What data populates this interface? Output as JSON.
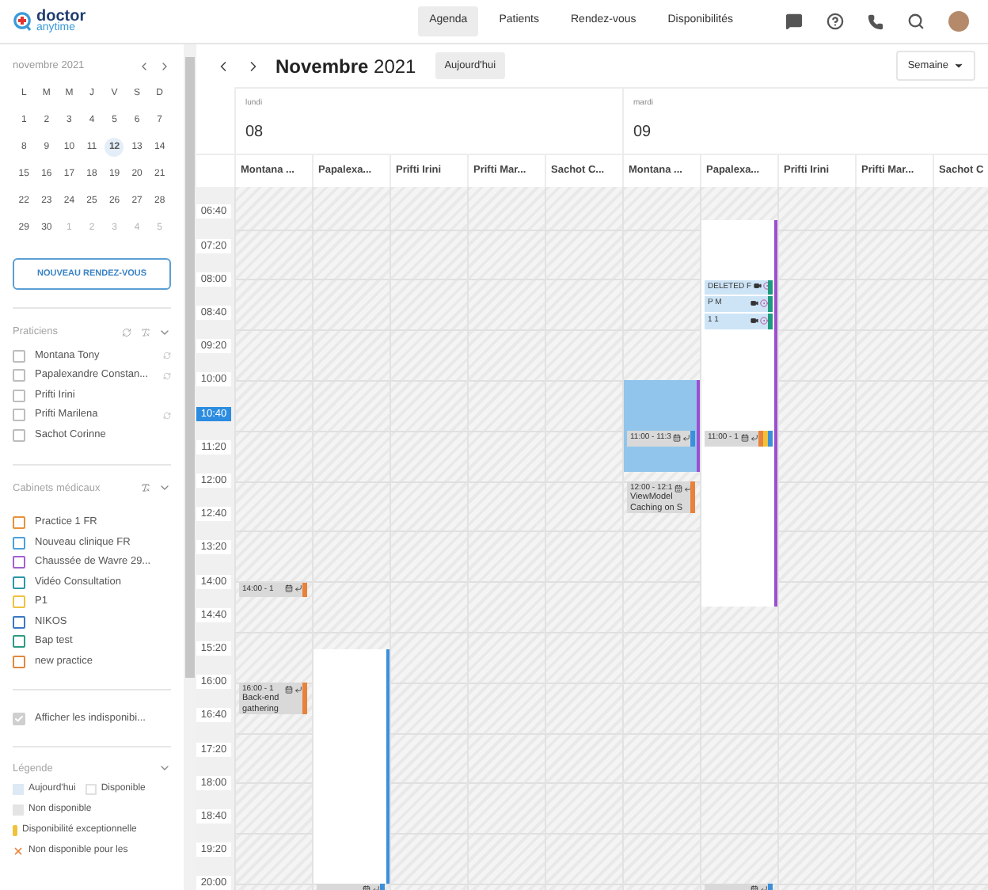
{
  "brand": {
    "name": "doctor",
    "tagline": "anytime"
  },
  "nav": [
    {
      "label": "Agenda",
      "selected": true
    },
    {
      "label": "Patients",
      "selected": false
    },
    {
      "label": "Rendez-vous",
      "selected": false
    },
    {
      "label": "Disponibilités",
      "selected": false
    }
  ],
  "mini_calendar": {
    "month": "novembre 2021",
    "weekdays": [
      "L",
      "M",
      "M",
      "J",
      "V",
      "S",
      "D"
    ],
    "weeks": [
      [
        {
          "day": "1",
          "outside": false,
          "selected": false
        },
        {
          "day": "2",
          "outside": false,
          "selected": false
        },
        {
          "day": "3",
          "outside": false,
          "selected": false
        },
        {
          "day": "4",
          "outside": false,
          "selected": false
        },
        {
          "day": "5",
          "outside": false,
          "selected": false
        },
        {
          "day": "6",
          "outside": false,
          "selected": false
        },
        {
          "day": "7",
          "outside": false,
          "selected": false
        }
      ],
      [
        {
          "day": "8",
          "outside": false,
          "selected": false
        },
        {
          "day": "9",
          "outside": false,
          "selected": false
        },
        {
          "day": "10",
          "outside": false,
          "selected": false
        },
        {
          "day": "11",
          "outside": false,
          "selected": false
        },
        {
          "day": "12",
          "outside": false,
          "selected": true
        },
        {
          "day": "13",
          "outside": false,
          "selected": false
        },
        {
          "day": "14",
          "outside": false,
          "selected": false
        }
      ],
      [
        {
          "day": "15",
          "outside": false,
          "selected": false
        },
        {
          "day": "16",
          "outside": false,
          "selected": false
        },
        {
          "day": "17",
          "outside": false,
          "selected": false
        },
        {
          "day": "18",
          "outside": false,
          "selected": false
        },
        {
          "day": "19",
          "outside": false,
          "selected": false
        },
        {
          "day": "20",
          "outside": false,
          "selected": false
        },
        {
          "day": "21",
          "outside": false,
          "selected": false
        }
      ],
      [
        {
          "day": "22",
          "outside": false,
          "selected": false
        },
        {
          "day": "23",
          "outside": false,
          "selected": false
        },
        {
          "day": "24",
          "outside": false,
          "selected": false
        },
        {
          "day": "25",
          "outside": false,
          "selected": false
        },
        {
          "day": "26",
          "outside": false,
          "selected": false
        },
        {
          "day": "27",
          "outside": false,
          "selected": false
        },
        {
          "day": "28",
          "outside": false,
          "selected": false
        }
      ],
      [
        {
          "day": "29",
          "outside": false,
          "selected": false
        },
        {
          "day": "30",
          "outside": false,
          "selected": false
        },
        {
          "day": "1",
          "outside": true,
          "selected": false
        },
        {
          "day": "2",
          "outside": true,
          "selected": false
        },
        {
          "day": "3",
          "outside": true,
          "selected": false
        },
        {
          "day": "4",
          "outside": true,
          "selected": false
        },
        {
          "day": "5",
          "outside": true,
          "selected": false
        }
      ]
    ]
  },
  "new_appointment_button": "NOUVEAU RENDEZ-VOUS",
  "practitioners": {
    "title": "Praticiens",
    "items": [
      {
        "name": "Montana Tony",
        "checked": false,
        "synced": true
      },
      {
        "name": "Papalexandre Constan...",
        "checked": false,
        "synced": true
      },
      {
        "name": "Prifti Irini",
        "checked": false,
        "synced": false
      },
      {
        "name": "Prifti Marilena",
        "checked": false,
        "synced": true
      },
      {
        "name": "Sachot Corinne",
        "checked": false,
        "synced": false
      }
    ]
  },
  "practices": {
    "title": "Cabinets médicaux",
    "items": [
      {
        "name": "Practice 1 FR",
        "checked": false,
        "color": "#e8913a"
      },
      {
        "name": "Nouveau clinique FR",
        "checked": false,
        "color": "#4aa0dc"
      },
      {
        "name": "Chaussée de Wavre 29...",
        "checked": false,
        "color": "#a35fd0"
      },
      {
        "name": "Vidéo Consultation",
        "checked": false,
        "color": "#2a98a8"
      },
      {
        "name": "P1",
        "checked": false,
        "color": "#f0c23c"
      },
      {
        "name": "NIKOS",
        "checked": false,
        "color": "#3a78c4"
      },
      {
        "name": "Bap test",
        "checked": false,
        "color": "#2e9a84"
      },
      {
        "name": "new practice",
        "checked": false,
        "color": "#e0883c"
      }
    ]
  },
  "show_unavailable": {
    "label": "Afficher les indisponibi...",
    "checked": true
  },
  "legend": {
    "title": "Légende",
    "items": [
      {
        "kind": "today",
        "label": "Aujourd'hui"
      },
      {
        "kind": "available",
        "label": "Disponible"
      },
      {
        "kind": "unavailable",
        "label": "Non disponible"
      },
      {
        "kind": "exceptional",
        "label": "Disponibilité exceptionnelle"
      },
      {
        "kind": "blocked",
        "label": "Non disponible pour les"
      }
    ]
  },
  "toolbar": {
    "title": "**Novembre** 2021",
    "today_button": "Aujourd'hui",
    "view": "Semaine"
  },
  "time_labels": [
    {
      "time": "06:40",
      "current": false
    },
    {
      "time": "07:20",
      "current": false
    },
    {
      "time": "08:00",
      "current": false
    },
    {
      "time": "08:40",
      "current": false
    },
    {
      "time": "09:20",
      "current": false
    },
    {
      "time": "10:00",
      "current": false
    },
    {
      "time": "10:40",
      "current": true
    },
    {
      "time": "11:20",
      "current": false
    },
    {
      "time": "12:00",
      "current": false
    },
    {
      "time": "12:40",
      "current": false
    },
    {
      "time": "13:20",
      "current": false
    },
    {
      "time": "14:00",
      "current": false
    },
    {
      "time": "14:40",
      "current": false
    },
    {
      "time": "15:20",
      "current": false
    },
    {
      "time": "16:00",
      "current": false
    },
    {
      "time": "16:40",
      "current": false
    },
    {
      "time": "17:20",
      "current": false
    },
    {
      "time": "18:00",
      "current": false
    },
    {
      "time": "18:40",
      "current": false
    },
    {
      "time": "19:20",
      "current": false
    },
    {
      "time": "20:00",
      "current": false
    }
  ],
  "days": [
    {
      "weekday": "lundi",
      "date": "08",
      "columns": [
        {
          "header": "Montana ...",
          "blocks": [
            {
              "kind": "appointment",
              "lines": [
                "14:00 - 1"
              ],
              "bars": [
                {
                  "color": "#e8823a"
                }
              ]
            },
            {
              "kind": "appointment",
              "lines": [
                "16:00 - 1",
                "Back-end",
                "gathering"
              ],
              "bars": [
                {
                  "color": "#e8823a"
                }
              ]
            }
          ]
        },
        {
          "header": "Papalexa...",
          "blocks": [
            {
              "kind": "availability",
              "bars": [
                {
                  "color": "#3b8fdb"
                }
              ]
            },
            {
              "kind": "appointment",
              "bars": [
                {
                  "color": "#3b8fdb"
                }
              ]
            }
          ]
        },
        {
          "header": "Prifti Irini"
        },
        {
          "header": "Prifti Mar..."
        },
        {
          "header": "Sachot C..."
        }
      ]
    },
    {
      "weekday": "mardi",
      "date": "09",
      "columns": [
        {
          "header": "Montana ...",
          "blocks": [
            {
              "kind": "highlight",
              "bars": [
                {
                  "color": "#9b4fd0"
                }
              ]
            },
            {
              "kind": "appointment",
              "lines": [
                "11:00 - 11:3"
              ],
              "bars": [
                {
                  "color": "#3b8fdb"
                }
              ]
            },
            {
              "kind": "appointment",
              "lines": [
                "12:00 - 12:1",
                "ViewModel",
                "Caching on S"
              ],
              "bars": [
                {
                  "color": "#e8823a"
                }
              ]
            }
          ]
        },
        {
          "header": "Papalexa...",
          "blocks": [
            {
              "kind": "availability",
              "bars": [
                {
                  "color": "#9b4fd0"
                }
              ]
            },
            {
              "kind": "online",
              "lines": [
                "DELETED F"
              ],
              "bars": [
                {
                  "color": "#1e9a80"
                }
              ]
            },
            {
              "kind": "online",
              "lines": [
                "P M"
              ],
              "bars": [
                {
                  "color": "#1e9a80"
                }
              ]
            },
            {
              "kind": "online",
              "lines": [
                "1 1"
              ],
              "bars": [
                {
                  "color": "#1e9a80"
                }
              ]
            },
            {
              "kind": "appointment",
              "lines": [
                "11:00 - 1"
              ],
              "bars": [
                {
                  "color": "#e8823a"
                },
                {
                  "color": "#f0c23c"
                },
                {
                  "color": "#3b8fdb"
                }
              ]
            },
            {
              "kind": "appointment",
              "bars": [
                {
                  "color": "#3b8fdb"
                }
              ]
            }
          ]
        },
        {
          "header": "Prifti Irini"
        },
        {
          "header": "Prifti Mar..."
        },
        {
          "header": "Sachot C"
        }
      ]
    }
  ]
}
